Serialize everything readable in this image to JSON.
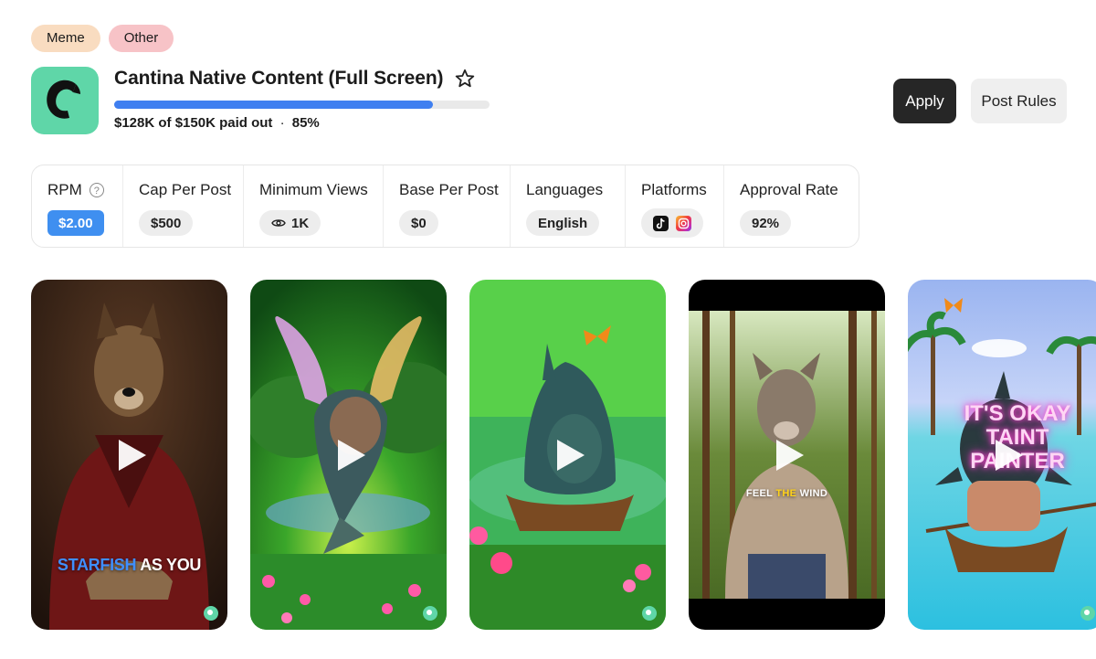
{
  "tags": [
    "Meme",
    "Other"
  ],
  "campaign": {
    "title": "Cantina Native Content (Full Screen)",
    "progress_fraction": 0.85,
    "paid_text": "$128K of $150K paid out",
    "separator": "·",
    "percent_text": "85%"
  },
  "actions": {
    "apply_label": "Apply",
    "rules_label": "Post Rules"
  },
  "stats": {
    "rpm": {
      "label": "RPM",
      "value": "$2.00"
    },
    "cap": {
      "label": "Cap Per Post",
      "value": "$500"
    },
    "min_views": {
      "label": "Minimum Views",
      "value": "1K"
    },
    "base": {
      "label": "Base Per Post",
      "value": "$0"
    },
    "languages": {
      "label": "Languages",
      "value": "English"
    },
    "platforms": {
      "label": "Platforms",
      "icons": [
        "tiktok-icon",
        "instagram-icon"
      ]
    },
    "approval": {
      "label": "Approval Rate",
      "value": "92%"
    }
  },
  "videos": [
    {
      "caption_highlight": "STARFISH",
      "caption_rest": " AS YOU"
    },
    {},
    {},
    {
      "caption_pre": "FEEL ",
      "caption_highlight": "THE",
      "caption_rest": " WIND"
    },
    {
      "neon_text": "IT'S OKAY TAINT PAINTER"
    }
  ],
  "colors": {
    "accent_blue": "#3f8ff0",
    "brand_green": "#5fd6a8",
    "apply_bg": "#262626"
  }
}
